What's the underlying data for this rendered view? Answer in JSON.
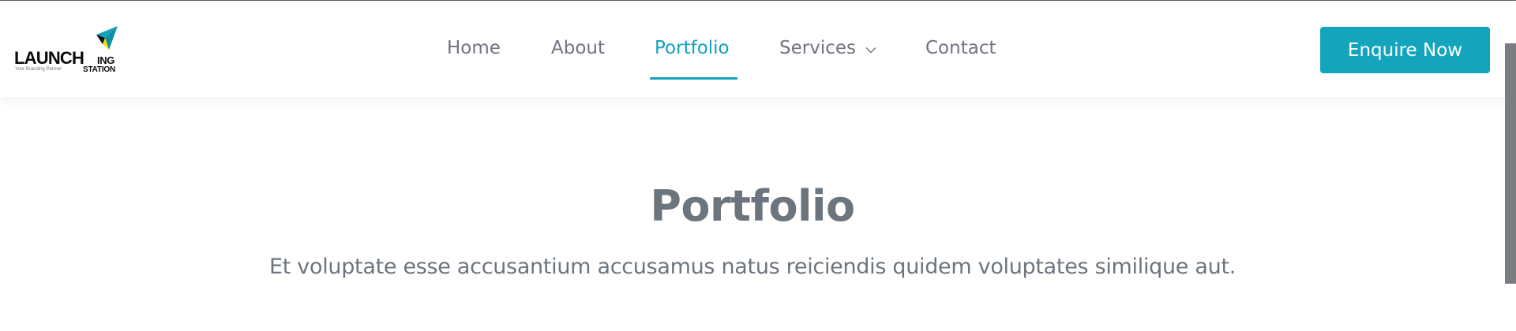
{
  "logo": {
    "main_text": "LAUNCH",
    "ing_text": "ING",
    "station_text": "STATION",
    "tagline": "Your Branding Partner",
    "icon": "paper-plane-icon",
    "colors": {
      "teal": "#14a1bb",
      "yellow": "#f2e300",
      "dark": "#0a0a0a"
    }
  },
  "nav": {
    "items": [
      {
        "label": "Home",
        "active": false
      },
      {
        "label": "About",
        "active": false
      },
      {
        "label": "Portfolio",
        "active": true
      },
      {
        "label": "Services",
        "active": false,
        "has_dropdown": true,
        "icon": "chevron-down-icon"
      },
      {
        "label": "Contact",
        "active": false
      }
    ]
  },
  "cta": {
    "label": "Enquire Now"
  },
  "hero": {
    "title": "Portfolio",
    "subtitle": "Et voluptate esse accusantium accusamus natus reiciendis quidem voluptates similique aut."
  },
  "colors": {
    "accent": "#14a1bb",
    "nav_text": "#717480",
    "hero_text": "#6c757d",
    "scrollbar": "#7a7d82"
  }
}
